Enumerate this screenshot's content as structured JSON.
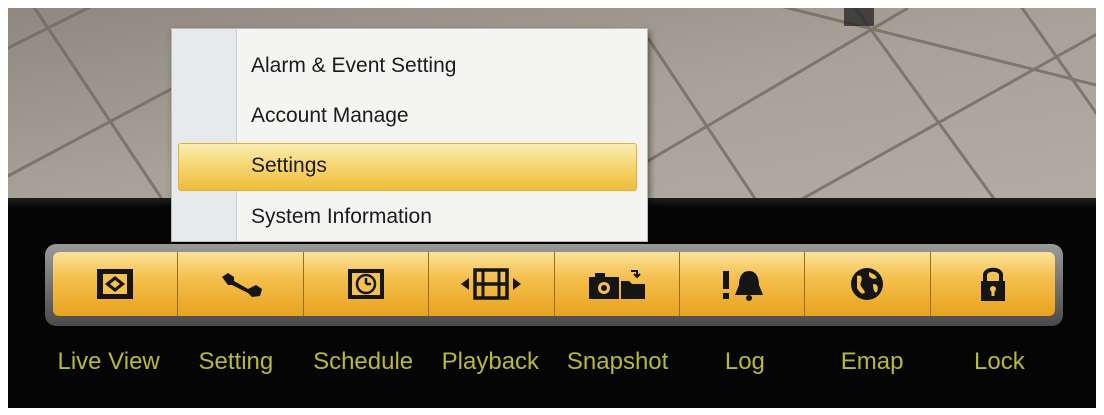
{
  "context_menu": {
    "items": [
      {
        "label": "Alarm & Event Setting",
        "highlighted": false
      },
      {
        "label": "Account Manage",
        "highlighted": false
      },
      {
        "label": "Settings",
        "highlighted": true
      },
      {
        "label": "System Information",
        "highlighted": false
      }
    ]
  },
  "toolbar": {
    "buttons": [
      {
        "label": "Live View",
        "icon": "live-view-icon"
      },
      {
        "label": "Setting",
        "icon": "wrench-icon"
      },
      {
        "label": "Schedule",
        "icon": "clock-icon"
      },
      {
        "label": "Playback",
        "icon": "film-playback-icon"
      },
      {
        "label": "Snapshot",
        "icon": "camera-folder-icon"
      },
      {
        "label": "Log",
        "icon": "alert-bell-icon"
      },
      {
        "label": "Emap",
        "icon": "globe-icon"
      },
      {
        "label": "Lock",
        "icon": "lock-icon"
      }
    ]
  },
  "colors": {
    "button_gold": "#f4c04e",
    "label_text": "#b8b83a",
    "highlight": "#f6d774"
  }
}
